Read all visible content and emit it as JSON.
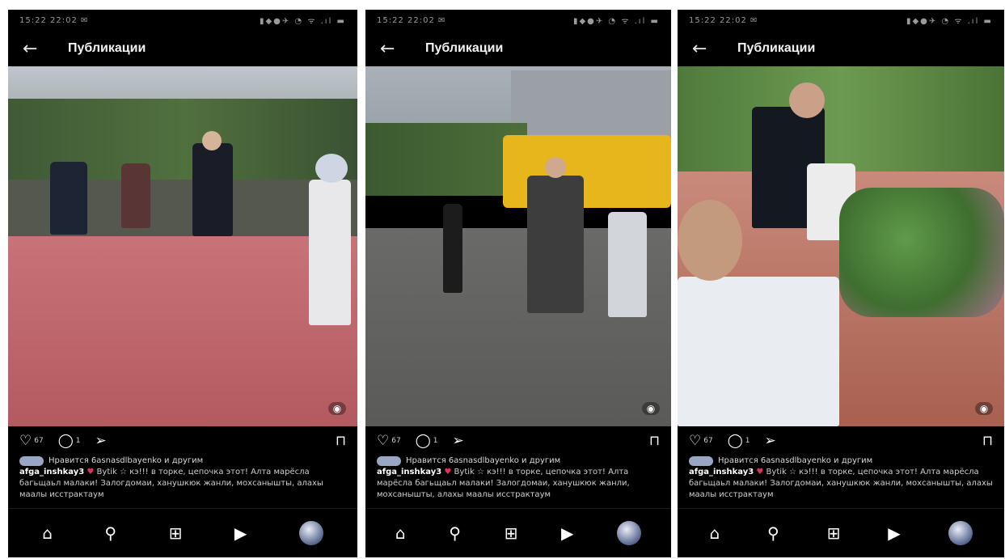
{
  "screens": [
    {
      "status_time": "15:22 22:02 ✉",
      "status_icons": "▮◆●✈ ◔ ᯤ .ıl ▬",
      "header_title": "Публикации",
      "likes": "67",
      "comments": "1",
      "liked_by": "Нравится 6asnasdlbayenko и другим",
      "caption_user": "afga_inshkay3",
      "caption_text": "Bytik ☆ кэ!!! в торке, цепочкa этот! Алта марёсла багьщаьл малаки! Залогдомаи, ханушкюк жанли, мохсанышты, алахы маалы исстрактаум"
    },
    {
      "status_time": "15:22 22:02 ✉",
      "status_icons": "▮◆●✈ ◔ ᯤ .ıl ▬",
      "header_title": "Публикации",
      "likes": "67",
      "comments": "1",
      "liked_by": "Нравится 6asnasdlbayenko и другим",
      "caption_user": "afga_inshkay3",
      "caption_text": "Bytik ☆ кэ!!! в торке, цепочкa этот! Алта марёсла багьщаьл малаки! Залогдомаи, ханушкюк жанли, мохсанышты, алахы маалы исстрактаум"
    },
    {
      "status_time": "15:22 22:02 ✉",
      "status_icons": "▮◆●✈ ◔ ᯤ .ıl ▬",
      "header_title": "Публикации",
      "likes": "67",
      "comments": "1",
      "liked_by": "Нравится 6asnasdlbayenko и другим",
      "caption_user": "afga_inshkay3",
      "caption_text": "Bytik ☆ кэ!!! в торке, цепочкa этот! Алта марёсла багьщаьл малаки! Залогдомаи, ханушкюк жанли, мохсанышты, алахы маалы исстрактаум"
    }
  ],
  "icons": {
    "back": "←",
    "heart": "♡",
    "comment": "◯",
    "share": "➢",
    "save": "⊓",
    "home": "⌂",
    "search": "⚲",
    "create": "⊞",
    "reels": "▶",
    "reel_badge": "◉"
  },
  "colors": {
    "bg": "#000000",
    "text": "#ffffff",
    "heart_emoji": "#e0335b"
  }
}
